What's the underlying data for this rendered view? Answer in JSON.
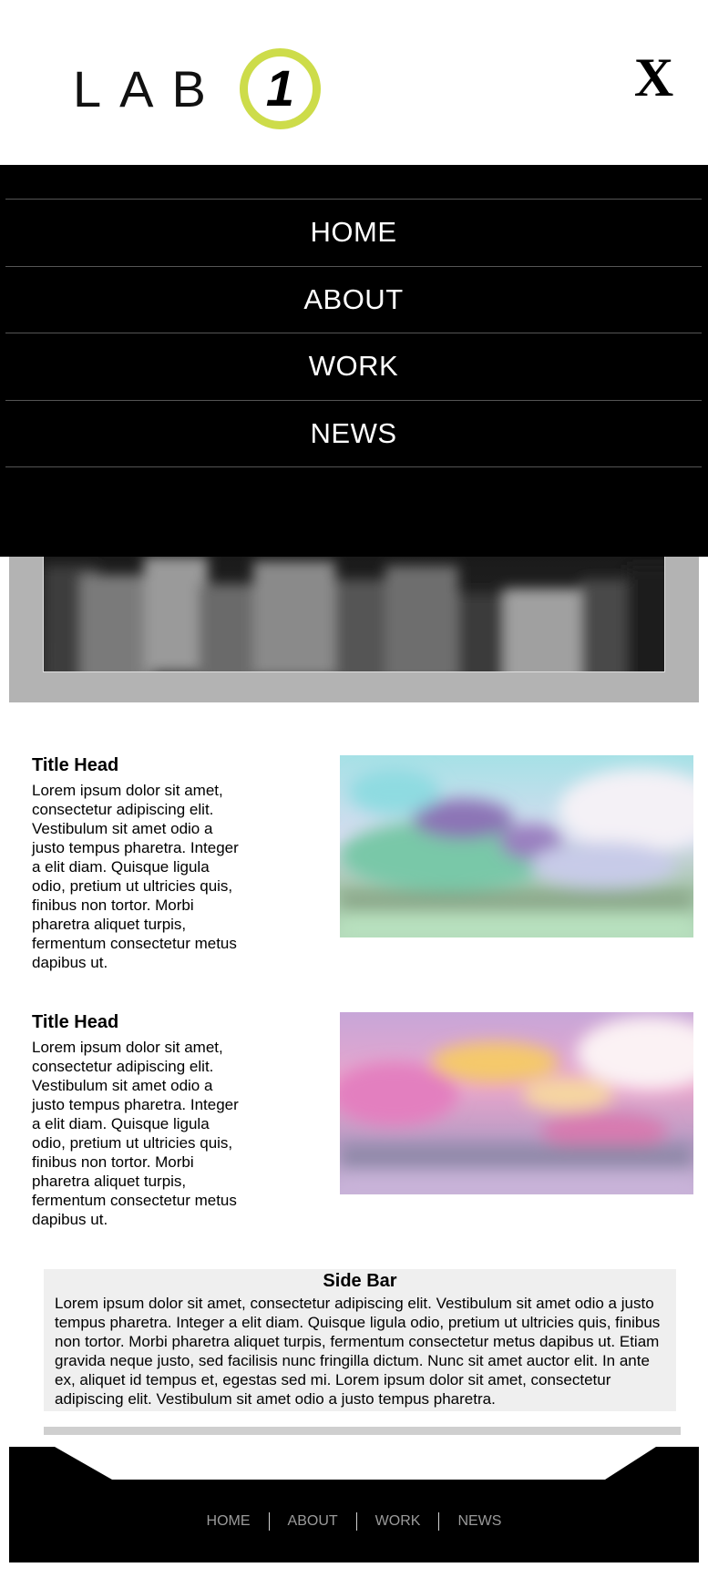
{
  "brand": {
    "logo_text": "LAB",
    "logo_number": "1",
    "accent_color": "#cddc4a"
  },
  "header": {
    "close_label": "X"
  },
  "nav": {
    "items": [
      {
        "label": "HOME"
      },
      {
        "label": "ABOUT"
      },
      {
        "label": "WORK"
      },
      {
        "label": "NEWS"
      }
    ]
  },
  "articles": [
    {
      "title": "Title Head",
      "body": "Lorem ipsum dolor sit amet, consectetur adipiscing elit. Vestibulum sit amet odio a justo tempus pharetra. Integer a elit diam. Quisque ligula odio, pretium ut ultricies quis, finibus non tortor. Morbi pharetra aliquet turpis, fermentum consectetur metus dapibus ut."
    },
    {
      "title": "Title Head",
      "body": "Lorem ipsum dolor sit amet, consectetur adipiscing elit. Vestibulum sit amet odio a justo tempus pharetra. Integer a elit diam. Quisque ligula odio, pretium ut ultricies quis, finibus non tortor. Morbi pharetra aliquet turpis, fermentum consectetur metus dapibus ut."
    }
  ],
  "sidebar": {
    "title": "Side Bar",
    "body": "Lorem ipsum dolor sit amet, consectetur adipiscing elit. Vestibulum sit amet odio a justo tempus pharetra. Integer a elit diam. Quisque ligula odio, pretium ut ultricies quis, finibus non tortor. Morbi pharetra aliquet turpis, fermentum consectetur metus dapibus ut. Etiam gravida neque justo, sed facilisis nunc fringilla dictum. Nunc sit amet auctor elit. In ante ex, aliquet id tempus et, egestas sed mi. Lorem ipsum dolor sit amet, consectetur adipiscing elit. Vestibulum sit amet odio a justo tempus pharetra."
  },
  "footer": {
    "links": [
      {
        "label": "HOME"
      },
      {
        "label": "ABOUT"
      },
      {
        "label": "WORK"
      },
      {
        "label": "NEWS"
      }
    ]
  }
}
